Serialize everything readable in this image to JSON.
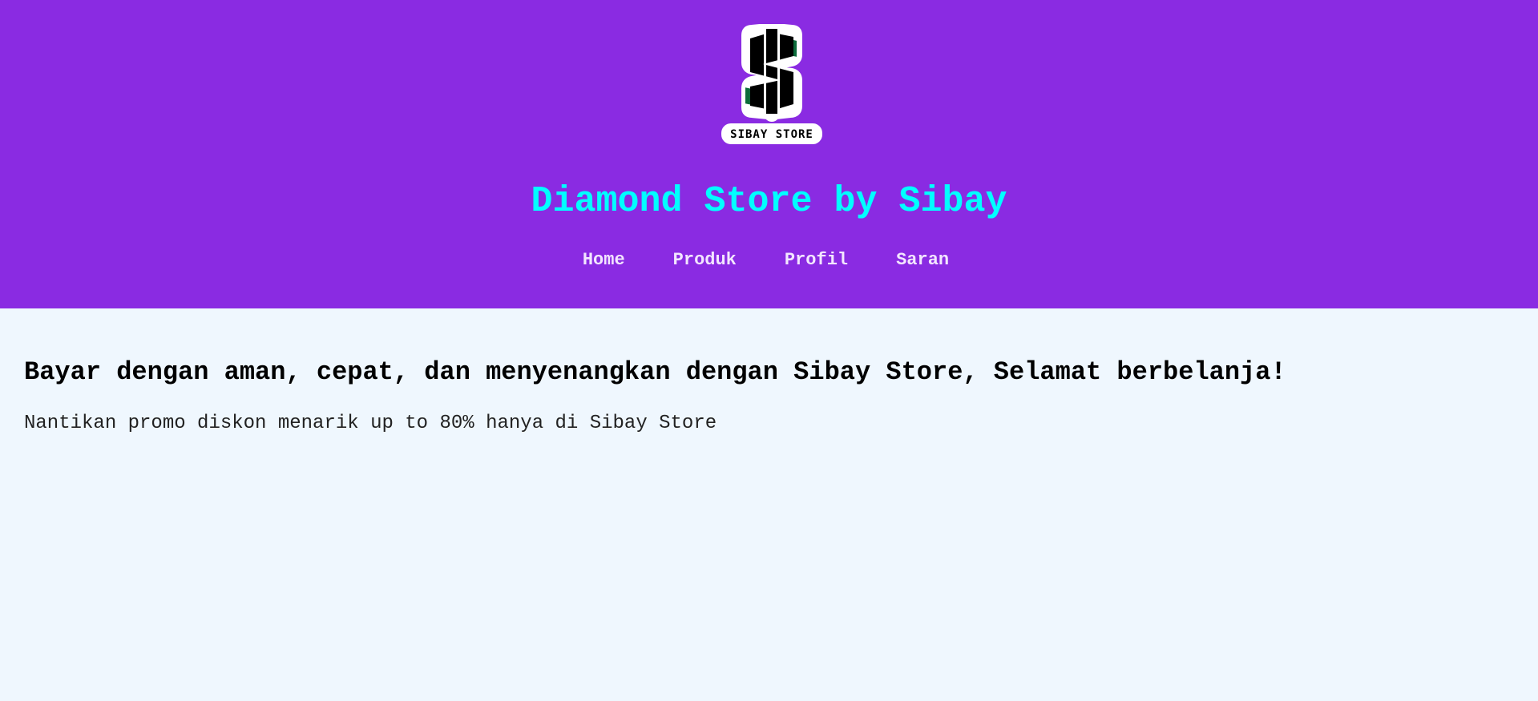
{
  "header": {
    "logo": {
      "text": "SIBAY STORE",
      "icon": "dollar-sign-icon",
      "colors": {
        "black": "#000000",
        "green": "#0b6b3a",
        "white": "#ffffff"
      }
    },
    "title": "Diamond Store by Sibay",
    "nav": [
      {
        "label": "Home"
      },
      {
        "label": "Produk"
      },
      {
        "label": "Profil"
      },
      {
        "label": "Saran"
      }
    ]
  },
  "main": {
    "heading": "Bayar dengan aman, cepat, dan menyenangkan dengan Sibay Store, Selamat berbelanja!",
    "promo": "Nantikan promo diskon menarik up to 80% hanya di Sibay Store"
  },
  "colors": {
    "header_bg": "#8a2be2",
    "title": "#00ffff",
    "nav_text": "#f3e6ff",
    "page_bg": "#eff7fe"
  }
}
